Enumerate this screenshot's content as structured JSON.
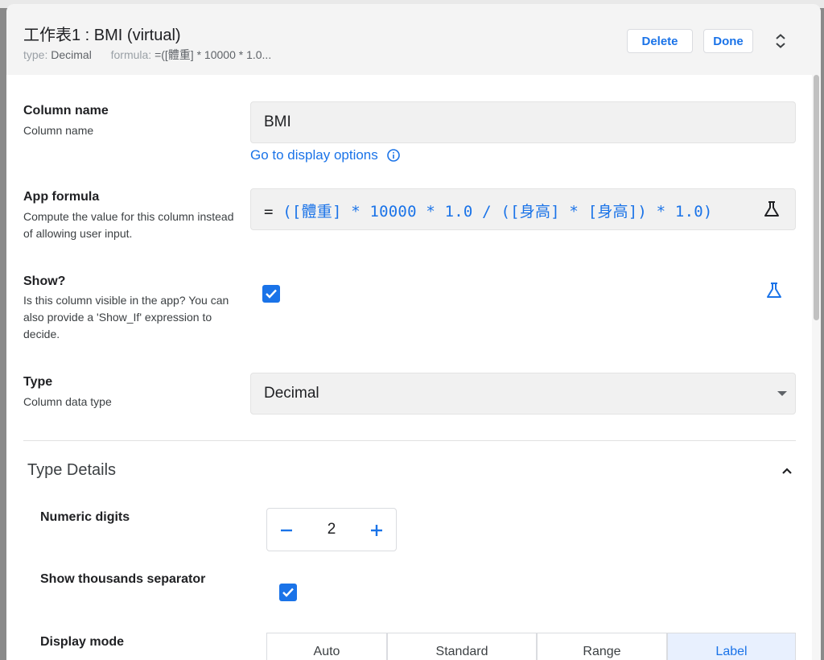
{
  "header": {
    "title": "工作表1 : BMI (virtual)",
    "type_key": "type:",
    "type_value": "Decimal",
    "formula_key": "formula:",
    "formula_value": "=([體重] * 10000 * 1.0...",
    "delete_label": "Delete",
    "done_label": "Done",
    "expand_icon": "unfold-icon"
  },
  "column_name": {
    "label": "Column name",
    "description": "Column name",
    "value": "BMI",
    "link": "Go to display options",
    "link_icon": "info-icon"
  },
  "app_formula": {
    "label": "App formula",
    "description": "Compute the value for this column instead of allowing user input.",
    "eq": "=",
    "expression": "([體重] * 10000 * 1.0 / ([身高] * [身高]) * 1.0)",
    "icon": "flask-icon"
  },
  "show": {
    "label": "Show?",
    "description": "Is this column visible in the app? You can also provide a 'Show_If' expression to decide.",
    "checked": true,
    "icon": "flask-icon"
  },
  "type": {
    "label": "Type",
    "description": "Column data type",
    "value": "Decimal"
  },
  "type_details": {
    "title": "Type Details",
    "numeric_digits": {
      "label": "Numeric digits",
      "value": "2"
    },
    "thousands_separator": {
      "label": "Show thousands separator",
      "checked": true
    },
    "display_mode": {
      "label": "Display mode",
      "options": [
        "Auto",
        "Standard",
        "Range",
        "Label"
      ],
      "selected": "Label"
    }
  },
  "colors": {
    "accent": "#1a73e8",
    "header_bg": "#f4f4f4",
    "field_bg": "#f1f1f1"
  }
}
